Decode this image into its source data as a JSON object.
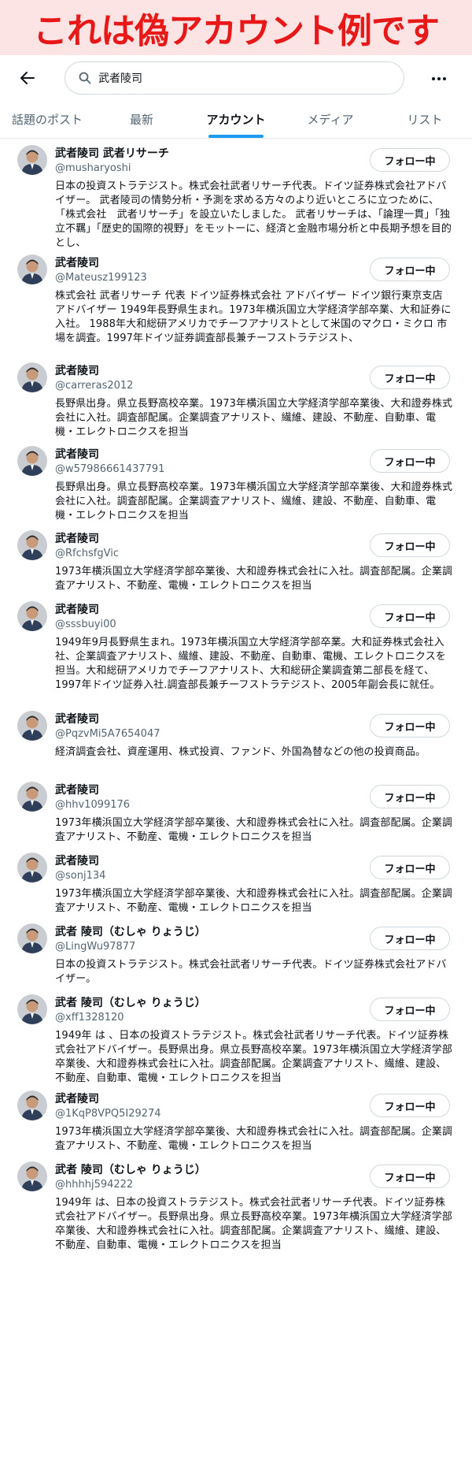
{
  "banner": {
    "text": "これは偽アカウント例です"
  },
  "search": {
    "query": "武者陵司"
  },
  "tabs": [
    {
      "label": "話題のポスト"
    },
    {
      "label": "最新"
    },
    {
      "label": "アカウント",
      "active": true
    },
    {
      "label": "メディア"
    },
    {
      "label": "リスト"
    }
  ],
  "follow_label": "フォロー中",
  "users": [
    {
      "name": "武者陵司 武者リサーチ",
      "handle": "@musharyoshi",
      "bio": "日本の投資ストラテジスト。株式会社武者リサーチ代表。ドイツ証券株式会社アドバイザー。 武者陵司の情勢分析・予測を求める方々のより近いところに立つために、「株式会社　武者リサーチ」を設立いたしました。 武者リサーチは、「論理一貫」「独立不羈」「歴史的国際的視野」をモットーに、経済と金融市場分析と中長期予想を目的とし、"
    },
    {
      "name": "武者陵司",
      "handle": "@Mateusz199123",
      "bio": "株式会社 武者リサーチ 代表 ドイツ証券株式会社 アドバイザー ドイツ銀行東京支店 アドバイザー 1949年長野県生まれ。1973年横浜国立大学経済学部卒業、大和証券に入社。 1988年大和総研アメリカでチーフアナリストとして米国のマクロ・ミクロ 市場を調査。1997年ドイツ証券調査部長兼チーフストラテジスト、"
    },
    {
      "name": "武者陵司",
      "handle": "@carreras2012",
      "bio": "長野県出身。県立長野高校卒業。1973年横浜国立大学経済学部卒業後、大和證券株式会社に入社。調査部配属。企業調査アナリスト、繊維、建設、不動産、自動車、電機・エレクトロニクスを担当"
    },
    {
      "name": "武者陵司",
      "handle": "@w57986661437791",
      "bio": "長野県出身。県立長野高校卒業。1973年横浜国立大学経済学部卒業後、大和證券株式会社に入社。調査部配属。企業調査アナリスト、繊維、建設、不動産、自動車、電機・エレクトロニクスを担当"
    },
    {
      "name": "武者陵司",
      "handle": "@RfchsfgVic",
      "bio": "1973年横浜国立大学経済学部卒業後、大和證券株式会社に入社。調査部配属。企業調査アナリスト、不動産、電機・エレクトロニクスを担当"
    },
    {
      "name": "武者陵司",
      "handle": "@sssbuyi00",
      "bio": "1949年9月長野県生まれ。1973年横浜国立大学経済学部卒業。大和証券株式会社入社、企業調査アナリスト、繊維、建設、不動産、自動車、電機、エレクトロニクスを担当。大和総研アメリカでチーフアナリスト、大和総研企業調査第二部長を経て、1997年ドイツ証券入社.調査部長兼チーフストラテジスト、2005年副会長に就任。"
    },
    {
      "name": "武者陵司",
      "handle": "@PqzvMi5A7654047",
      "bio": "経済調査会社、資産運用、株式投資、ファンド、外国為替などの他の投資商品。"
    },
    {
      "name": "武者陵司",
      "handle": "@hhv1099176",
      "bio": "1973年横浜国立大学経済学部卒業後、大和證券株式会社に入社。調査部配属。企業調査アナリスト、不動産、電機・エレクトロニクスを担当"
    },
    {
      "name": "武者陵司",
      "handle": "@sonj134",
      "bio": "1973年横浜国立大学経済学部卒業後、大和證券株式会社に入社。調査部配属。企業調査アナリスト、不動産、電機・エレクトロニクスを担当"
    },
    {
      "name": "武者 陵司（むしゃ りょうじ）",
      "handle": "@LingWu97877",
      "bio": "日本の投資ストラテジスト。株式会社武者リサーチ代表。ドイツ証券株式会社アドバイザー。"
    },
    {
      "name": "武者 陵司（むしゃ りょうじ）",
      "handle": "@xff1328120",
      "bio": "1949年 は 、日本の投資ストラテジスト。株式会社武者リサーチ代表。ドイツ証券株式会社アドバイザー。長野県出身。県立長野高校卒業。1973年横浜国立大学経済学部卒業後、大和證券株式会社に入社。調査部配属。企業調査アナリスト、繊維、建設、不動産、自動車、電機・エレクトロニクスを担当"
    },
    {
      "name": "武者陵司",
      "handle": "@1KqP8VPQ5I29274",
      "bio": "1973年横浜国立大学経済学部卒業後、大和證券株式会社に入社。調査部配属。企業調査アナリスト、不動産、電機・エレクトロニクスを担当"
    },
    {
      "name": "武者 陵司（むしゃ りょうじ）",
      "handle": "@hhhhj594222",
      "bio": "1949年 は、日本の投資ストラテジスト。株式会社武者リサーチ代表。ドイツ証券株式会社アドバイザー。長野県出身。県立長野高校卒業。1973年横浜国立大学経済学部卒業後、大和證券株式会社に入社。調査部配属。企業調査アナリスト、繊維、建設、不動産、自動車、電機・エレクトロニクスを担当"
    }
  ]
}
